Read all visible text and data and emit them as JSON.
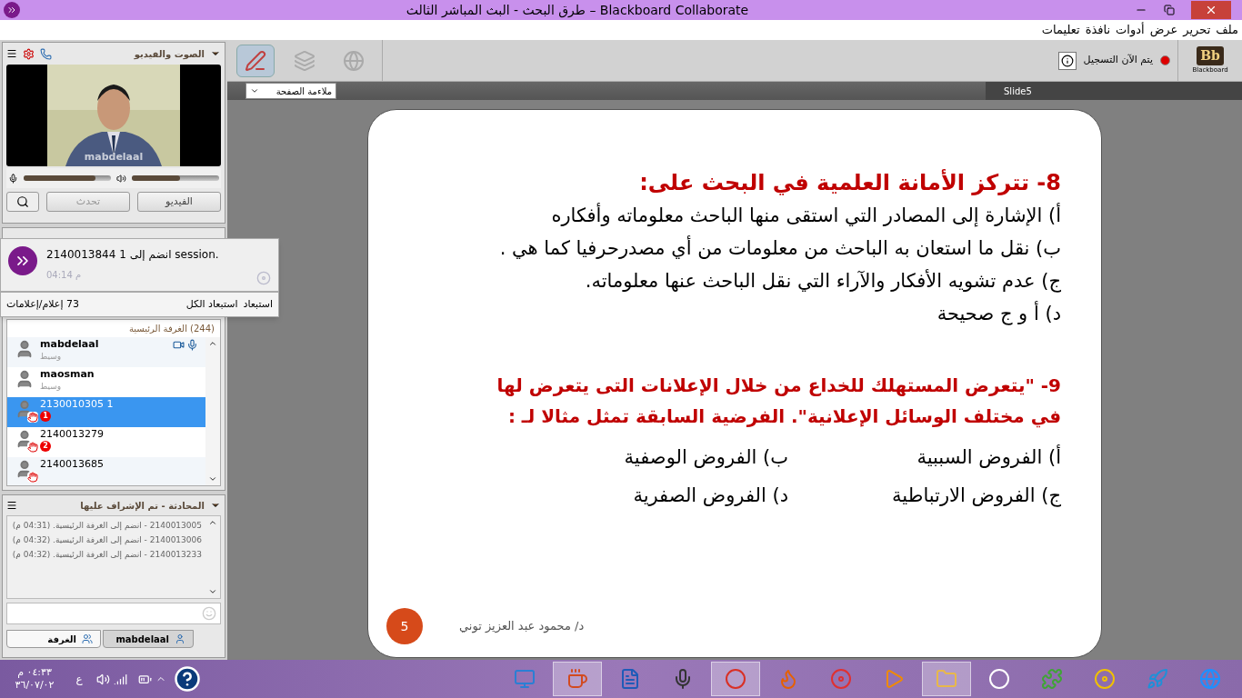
{
  "window": {
    "title": "طرق البحث - البث المباشر الثالث – Blackboard Collaborate"
  },
  "menu": [
    {
      "label": "ملف"
    },
    {
      "label": "تحرير"
    },
    {
      "label": "عرض"
    },
    {
      "label": "أدوات"
    },
    {
      "label": "نافذة"
    },
    {
      "label": "تعليمات"
    }
  ],
  "audio_video": {
    "title": "الصوت والفيديو",
    "video_name": "mabdelaal",
    "mic": {
      "level": 0.82
    },
    "speaker": {
      "level": 0.55
    },
    "buttons": [
      {
        "label": "الفيديو",
        "disabled": false
      },
      {
        "label": "تحدث",
        "disabled": true
      }
    ]
  },
  "notification": {
    "text": "2140013844 1 انضم إلى session.",
    "time": "04:14 م"
  },
  "participants": {
    "actions": [
      {
        "label": "استبعاد"
      },
      {
        "label": "استبعاد الكل"
      }
    ],
    "count": "73 إعلام/إعلامات",
    "room": "(244) الغرفة الرئيسية",
    "rows": [
      {
        "name": "mabdelaal",
        "role": "وسيط",
        "kind": "moderator",
        "selected": false,
        "hand": false,
        "media": true
      },
      {
        "name": "maosman",
        "role": "وسيط",
        "kind": "moderator",
        "selected": false,
        "hand": false,
        "media": false
      },
      {
        "name": "2130010305 1",
        "kind": "participant",
        "selected": true,
        "hand": true,
        "badge": "1",
        "media": false
      },
      {
        "name": "2140013279",
        "kind": "participant",
        "selected": false,
        "hand": true,
        "badge": "2",
        "media": false
      },
      {
        "name": "2140013685",
        "kind": "participant",
        "selected": false,
        "hand": true,
        "media": false
      }
    ]
  },
  "chat": {
    "title": "المحادثة - تم الإشراف عليها",
    "messages": [
      {
        "text": "2140013005 - انضم إلى الغرفة الرئيسية. (04:31 م)"
      },
      {
        "text": "2140013006 - انضم إلى الغرفة الرئيسية. (04:32 م)"
      },
      {
        "text": "2140013233 - انضم إلى الغرفة الرئيسية. (04:32 م)"
      }
    ],
    "tabs": [
      {
        "label": "mabdelaal",
        "selected": false
      },
      {
        "label": "الغرفة",
        "selected": true
      }
    ]
  },
  "toolbar": {
    "tools": [
      {
        "kind": "whiteboard",
        "selected": true
      },
      {
        "kind": "app-share",
        "selected": false
      },
      {
        "kind": "web-tour",
        "selected": false
      }
    ],
    "recording": {
      "label": "يتم الآن التسجيل",
      "on": true
    },
    "logo": {
      "mark": "Bb",
      "name": "Blackboard"
    },
    "zoom": "ملاءمة الصفحة",
    "slide_tab": "Slide5"
  },
  "slide": {
    "q8": {
      "title": "8- تتركز الأمانة العلمية في البحث على:",
      "options": [
        "أ) الإشارة إلى المصادر التي استقى منها الباحث معلوماته وأفكاره",
        "ب) نقل ما استعان به الباحث من معلومات من أي مصدرحرفيا كما هي .",
        "ج) عدم تشويه الأفكار والآراء التي نقل الباحث عنها معلوماته.",
        "د) أ و ج صحيحة"
      ]
    },
    "q9": {
      "title": [
        "9- \"يتعرض المستهلك للخداع من خلال الإعلانات التى يتعرض لها",
        "في مختلف الوسائل الإعلانية\". الفرضية السابقة تمثل مثالا لـ :"
      ],
      "options": [
        "أ) الفروض السببية",
        "ب) الفروض الوصفية",
        "ج) الفروض الارتباطية",
        "د) الفروض الصفرية"
      ]
    },
    "author": "د/ محمود عبد العزيز توني",
    "page": "5"
  },
  "taskbar": {
    "time": "٠٤:٣٣ م",
    "date": "٣٦/٠٧/٠٢",
    "language": "ع",
    "apps": [
      {
        "kind": "monitor",
        "active": false
      },
      {
        "kind": "java",
        "active": true
      },
      {
        "kind": "word",
        "active": false
      },
      {
        "kind": "mic",
        "active": false
      },
      {
        "kind": "chrome",
        "active": true
      },
      {
        "kind": "firefox",
        "active": false
      },
      {
        "kind": "recorder",
        "active": false
      },
      {
        "kind": "player",
        "active": false
      },
      {
        "kind": "folder",
        "active": true
      },
      {
        "kind": "hp",
        "active": false
      },
      {
        "kind": "puzzle",
        "active": false
      },
      {
        "kind": "speaker",
        "active": false
      },
      {
        "kind": "rocket",
        "active": false
      },
      {
        "kind": "ie",
        "active": false
      }
    ]
  }
}
